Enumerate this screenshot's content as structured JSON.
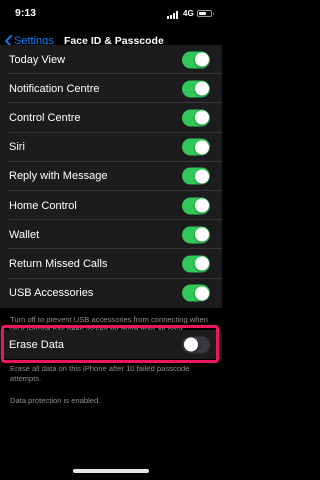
{
  "status_bar": {
    "time": "9:13",
    "network": "4G",
    "battery_level": 0.65
  },
  "nav": {
    "back_label": "Settings",
    "title": "Face ID & Passcode"
  },
  "usage_rows": [
    {
      "label": "Today View",
      "on": true
    },
    {
      "label": "Notification Centre",
      "on": true
    },
    {
      "label": "Control Centre",
      "on": true
    },
    {
      "label": "Siri",
      "on": true
    },
    {
      "label": "Reply with Message",
      "on": true
    },
    {
      "label": "Home Control",
      "on": true
    },
    {
      "label": "Wallet",
      "on": true
    },
    {
      "label": "Return Missed Calls",
      "on": true
    },
    {
      "label": "USB Accessories",
      "on": true
    }
  ],
  "usb_footer": "Turn off to prevent USB accessories from connecting when your iPhone has been locked for more than an hour.",
  "erase": {
    "label": "Erase Data",
    "on": false
  },
  "erase_footer": "Erase all data on this iPhone after 10 failed passcode attempts.",
  "protection_note": "Data protection is enabled.",
  "colors": {
    "toggle_on": "#32c759",
    "toggle_off": "#39393d",
    "accent": "#0a84ff",
    "highlight": "#e8195a"
  }
}
